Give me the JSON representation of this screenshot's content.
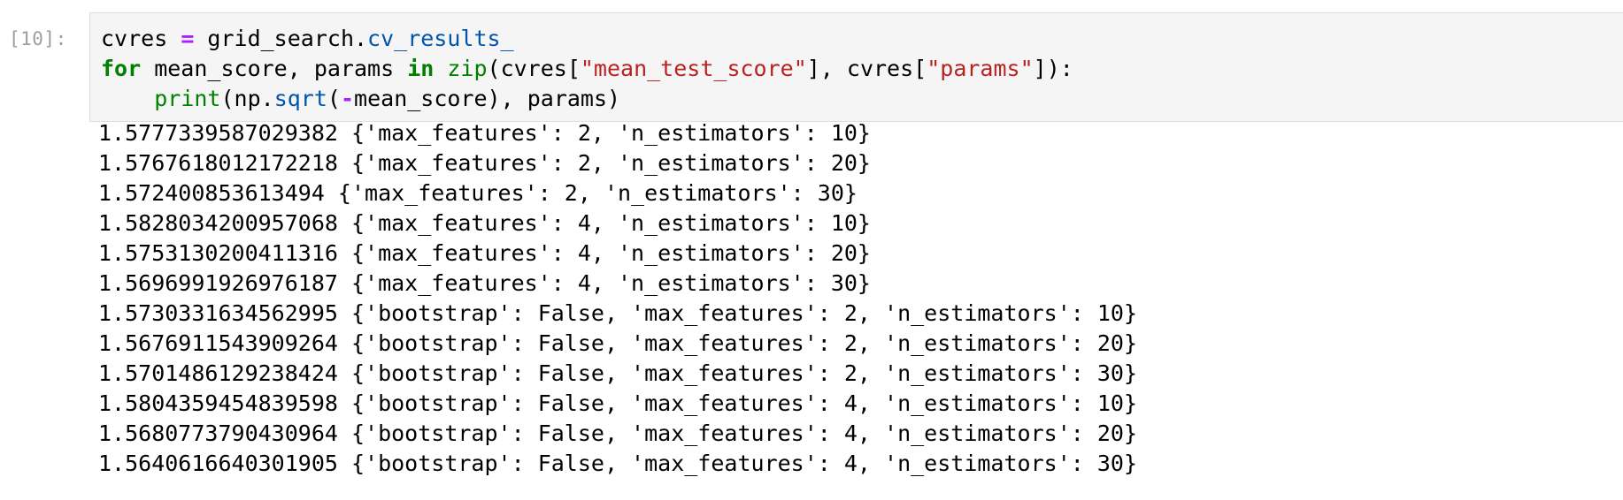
{
  "cell": {
    "prompt": "[10]:",
    "code": {
      "line1": {
        "var": "cvres ",
        "op": "=",
        "mid": " grid_search.",
        "attr": "cv_results_"
      },
      "line2": {
        "kw_for": "for",
        "t1": " mean_score, params ",
        "kw_in": "in",
        "t2": " ",
        "zip": "zip",
        "t3": "(cvres[",
        "s1": "\"mean_test_score\"",
        "t4": "], cvres[",
        "s2": "\"params\"",
        "t5": "]):"
      },
      "line3": {
        "indent": "    ",
        "print": "print",
        "t1": "(np.",
        "sqrt": "sqrt",
        "t2": "(",
        "neg": "-",
        "t3": "mean_score), params)"
      }
    },
    "output_lines": [
      "1.5777339587029382 {'max_features': 2, 'n_estimators': 10}",
      "1.5767618012172218 {'max_features': 2, 'n_estimators': 20}",
      "1.572400853613494 {'max_features': 2, 'n_estimators': 30}",
      "1.5828034200957068 {'max_features': 4, 'n_estimators': 10}",
      "1.5753130200411316 {'max_features': 4, 'n_estimators': 20}",
      "1.5696991926976187 {'max_features': 4, 'n_estimators': 30}",
      "1.5730331634562995 {'bootstrap': False, 'max_features': 2, 'n_estimators': 10}",
      "1.5676911543909264 {'bootstrap': False, 'max_features': 2, 'n_estimators': 20}",
      "1.5701486129238424 {'bootstrap': False, 'max_features': 2, 'n_estimators': 30}",
      "1.5804359454839598 {'bootstrap': False, 'max_features': 4, 'n_estimators': 10}",
      "1.5680773790430964 {'bootstrap': False, 'max_features': 4, 'n_estimators': 20}",
      "1.5640616640301905 {'bootstrap': False, 'max_features': 4, 'n_estimators': 30}"
    ]
  },
  "colors": {
    "keyword": "#008000",
    "operator": "#aa22ff",
    "attribute": "#0055aa",
    "string": "#ba2121",
    "prompt": "#9e9e9e",
    "input_background": "#f5f5f5"
  }
}
